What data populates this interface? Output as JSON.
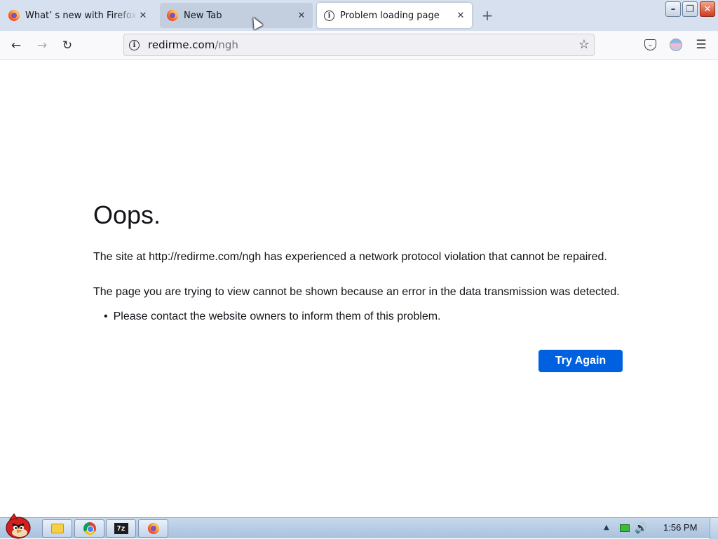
{
  "tabs": [
    {
      "title": "What’ s new with Firefox - M",
      "favicon": "firefox-icon",
      "active": false
    },
    {
      "title": "New Tab",
      "favicon": "firefox-icon",
      "active": false
    },
    {
      "title": "Problem loading page",
      "favicon": "info-icon",
      "active": true
    }
  ],
  "toolbar": {
    "url_domain": "redirme.com",
    "url_path": "/ngh"
  },
  "error": {
    "title": "Oops.",
    "paragraph1": "The site at http://redirme.com/ngh has experienced a network protocol violation that cannot be repaired.",
    "paragraph2": "The page you are trying to view cannot be shown because an error in the data transmission was detected.",
    "bullets": [
      "Please contact the website owners to inform them of this problem."
    ],
    "button_label": "Try Again"
  },
  "taskbar": {
    "items": [
      "file-explorer-icon",
      "chrome-icon",
      "7zip-icon",
      "firefox-icon"
    ],
    "zip_label": "7z",
    "clock": "1:56 PM"
  },
  "colors": {
    "accent": "#0061e0",
    "tabstrip": "#d6e0ee"
  }
}
